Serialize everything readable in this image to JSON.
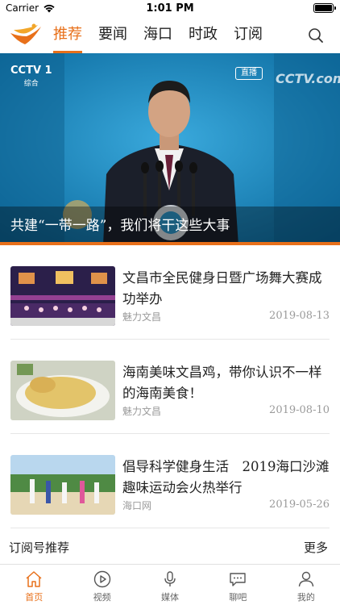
{
  "status_bar": {
    "carrier": "Carrier",
    "time": "1:01 PM"
  },
  "nav": {
    "tabs": [
      {
        "label": "推荐",
        "active": true
      },
      {
        "label": "要闻",
        "active": false
      },
      {
        "label": "海口",
        "active": false
      },
      {
        "label": "时政",
        "active": false
      },
      {
        "label": "订阅",
        "active": false
      }
    ],
    "accent_color": "#e8701a"
  },
  "banner": {
    "channel": "CCTV 1",
    "channel_sub": "综合",
    "live_badge": "直播",
    "watermark": "CCTV.com",
    "caption": "共建“一带一路”，我们将干这些大事"
  },
  "news": [
    {
      "title": "文昌市全民健身日暨广场舞大赛成功举办",
      "source": "魅力文昌",
      "date": "2019-08-13",
      "image": "dance-stage-photo"
    },
    {
      "title": "海南美味文昌鸡，带你认识不一样的海南美食！",
      "source": "魅力文昌",
      "date": "2019-08-10",
      "image": "wenchang-chicken-photo"
    },
    {
      "title": "倡导科学健身生活　2019海口沙滩趣味运动会火热举行",
      "source": "海口网",
      "date": "2019-05-26",
      "image": "beach-sports-photo"
    }
  ],
  "subscribe": {
    "title": "订阅号推荐",
    "more": "更多"
  },
  "tabbar": [
    {
      "label": "首页",
      "icon": "home-icon",
      "active": true
    },
    {
      "label": "视频",
      "icon": "video-icon",
      "active": false
    },
    {
      "label": "媒体",
      "icon": "microphone-icon",
      "active": false
    },
    {
      "label": "聊吧",
      "icon": "chat-icon",
      "active": false
    },
    {
      "label": "我的",
      "icon": "user-icon",
      "active": false
    }
  ]
}
